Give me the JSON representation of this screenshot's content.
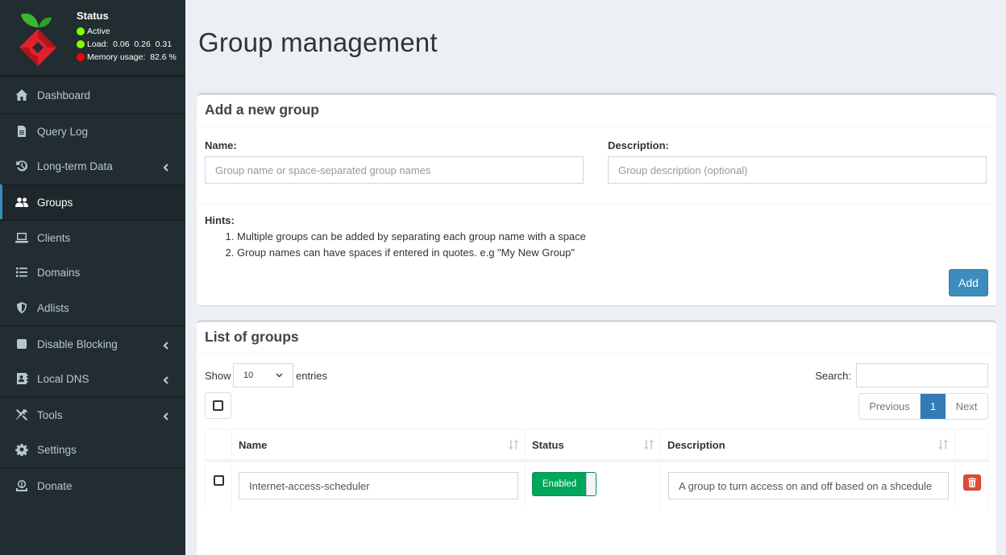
{
  "sidebar": {
    "status": {
      "title": "Status",
      "active_label": "Active",
      "load_label": "Load:  0.06  0.26  0.31",
      "memory_label": "Memory usage:  82.6 %",
      "colors": {
        "active": "#7fff00",
        "load": "#7fff00",
        "memory": "#ff0000"
      }
    },
    "items": [
      {
        "label": "Dashboard",
        "icon": "home-icon"
      },
      {
        "label": "Query Log",
        "icon": "file-icon"
      },
      {
        "label": "Long-term Data",
        "icon": "history-icon",
        "expandable": true
      },
      {
        "label": "Groups",
        "icon": "users-icon",
        "active": true
      },
      {
        "label": "Clients",
        "icon": "laptop-icon"
      },
      {
        "label": "Domains",
        "icon": "list-icon"
      },
      {
        "label": "Adlists",
        "icon": "shield-icon"
      },
      {
        "label": "Disable Blocking",
        "icon": "stop-icon",
        "expandable": true
      },
      {
        "label": "Local DNS",
        "icon": "address-book-icon",
        "expandable": true
      },
      {
        "label": "Tools",
        "icon": "tools-icon",
        "expandable": true
      },
      {
        "label": "Settings",
        "icon": "gear-icon"
      },
      {
        "label": "Donate",
        "icon": "donate-icon"
      }
    ]
  },
  "page": {
    "title": "Group management"
  },
  "add_group": {
    "title": "Add a new group",
    "name_label": "Name:",
    "name_placeholder": "Group name or space-separated group names",
    "description_label": "Description:",
    "description_placeholder": "Group description (optional)",
    "hints_title": "Hints:",
    "hints": [
      "Multiple groups can be added by separating each group name with a space",
      "Group names can have spaces if entered in quotes. e.g \"My New Group\""
    ],
    "add_button": "Add"
  },
  "list_groups": {
    "title": "List of groups",
    "show_label": "Show",
    "page_length": "10",
    "entries_label": "entries",
    "search_label": "Search:",
    "search_value": "",
    "pagination": {
      "previous": "Previous",
      "current": "1",
      "next": "Next"
    },
    "columns": [
      "Name",
      "Status",
      "Description"
    ],
    "rows": [
      {
        "name": "Internet-access-scheduler",
        "status": "Enabled",
        "description": "A group to turn access on and off based on a shcedule"
      }
    ]
  }
}
